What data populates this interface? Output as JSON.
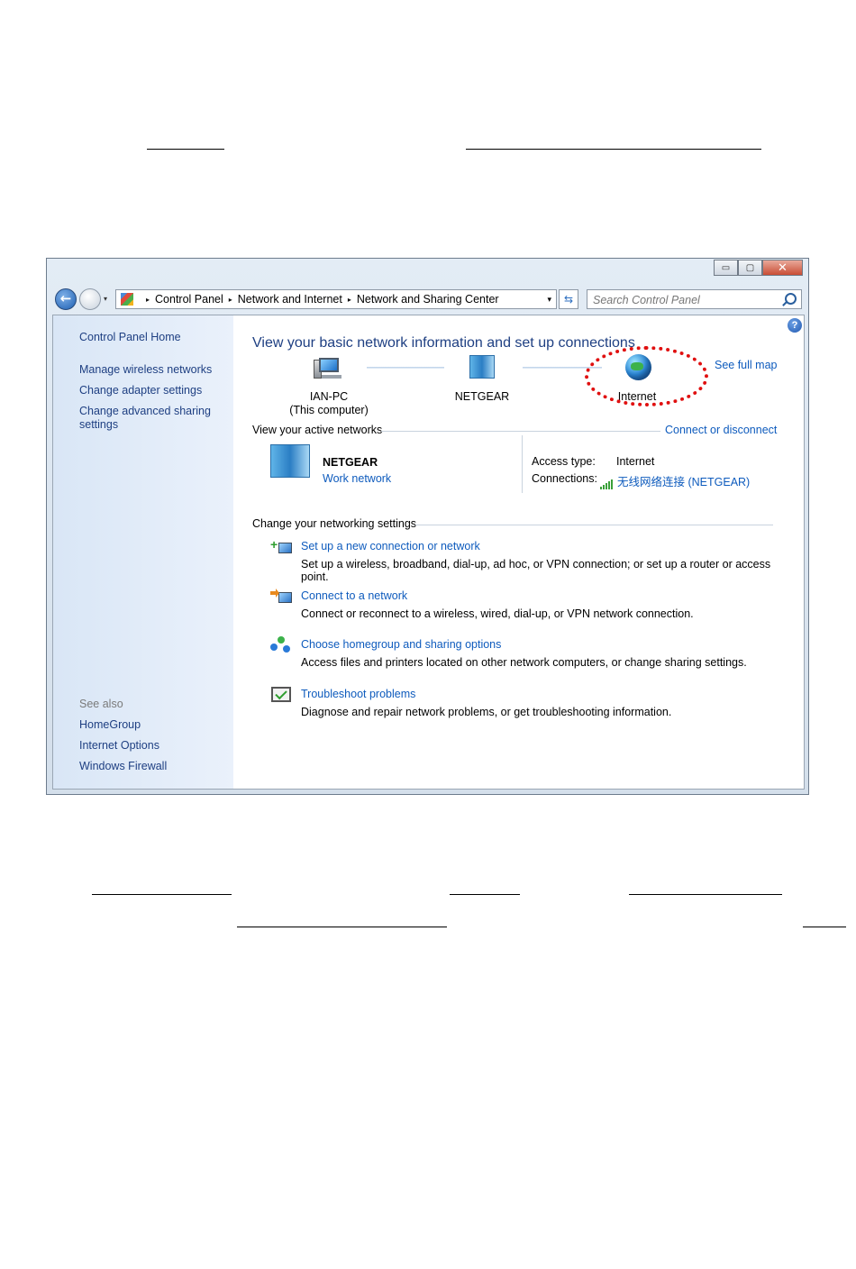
{
  "window": {
    "caption_buttons": {
      "minimize": "▭",
      "maximize": "▢",
      "close": "✕"
    },
    "nav": {
      "back_glyph": "←",
      "history_glyph": "▾"
    },
    "breadcrumb": [
      "Control Panel",
      "Network and Internet",
      "Network and Sharing Center"
    ],
    "breadcrumb_separator": "▸",
    "address_dropdown": "▾",
    "refresh_glyph": "⇆",
    "search_placeholder": "Search Control Panel",
    "help_glyph": "?"
  },
  "sidebar": {
    "home": "Control Panel Home",
    "tasks": [
      "Manage wireless networks",
      "Change adapter settings",
      "Change advanced sharing settings"
    ],
    "see_also_label": "See also",
    "see_also": [
      "HomeGroup",
      "Internet Options",
      "Windows Firewall"
    ]
  },
  "main": {
    "title": "View your basic network information and set up connections",
    "see_full_map": "See full map",
    "map": {
      "computer_name": "IAN-PC",
      "computer_note": "(This computer)",
      "network": "NETGEAR",
      "internet": "Internet"
    },
    "active_networks": {
      "heading": "View your active networks",
      "connect_link": "Connect or disconnect",
      "name": "NETGEAR",
      "type": "Work network",
      "access_label": "Access type:",
      "access_value": "Internet",
      "connections_label": "Connections:",
      "connections_value": "无线网络连接 (NETGEAR)"
    },
    "settings": {
      "heading": "Change your networking settings",
      "items": [
        {
          "title": "Set up a new connection or network",
          "desc": "Set up a wireless, broadband, dial-up, ad hoc, or VPN connection; or set up a router or access point.",
          "icon": "new-connection-icon"
        },
        {
          "title": "Connect to a network",
          "desc": "Connect or reconnect to a wireless, wired, dial-up, or VPN network connection.",
          "icon": "connect-network-icon"
        },
        {
          "title": "Choose homegroup and sharing options",
          "desc": "Access files and printers located on other network computers, or change sharing settings.",
          "icon": "homegroup-icon"
        },
        {
          "title": "Troubleshoot problems",
          "desc": "Diagnose and repair network problems, or get troubleshooting information.",
          "icon": "troubleshoot-icon"
        }
      ]
    }
  },
  "colors": {
    "link": "#0e5bbd",
    "title": "#1e3f82",
    "highlight": "#e01010"
  }
}
